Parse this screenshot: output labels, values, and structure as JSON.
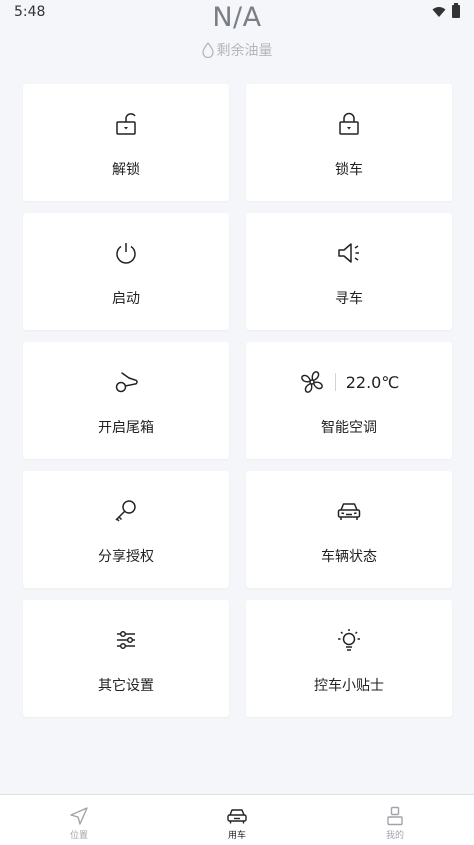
{
  "status": {
    "time": "5:48"
  },
  "fuel": {
    "value": "N/A",
    "label": "剩余油量"
  },
  "controls": {
    "unlock": "解锁",
    "lock": "锁车",
    "start": "启动",
    "find_car": "寻车",
    "trunk": "开启尾箱",
    "ac": "智能空调",
    "ac_temp": "22.0℃",
    "share": "分享授权",
    "vehicle_status": "车辆状态",
    "other_settings": "其它设置",
    "tips": "控车小贴士"
  },
  "tabs": [
    {
      "label": "位置",
      "icon": "navigation-arrow-icon",
      "active": false
    },
    {
      "label": "用车",
      "icon": "car-icon",
      "active": true
    },
    {
      "label": "我的",
      "icon": "person-icon",
      "active": false
    }
  ],
  "colors": {
    "background": "#f4f6f9",
    "card": "#ffffff",
    "text": "#222222",
    "muted": "#a0a4aa"
  }
}
